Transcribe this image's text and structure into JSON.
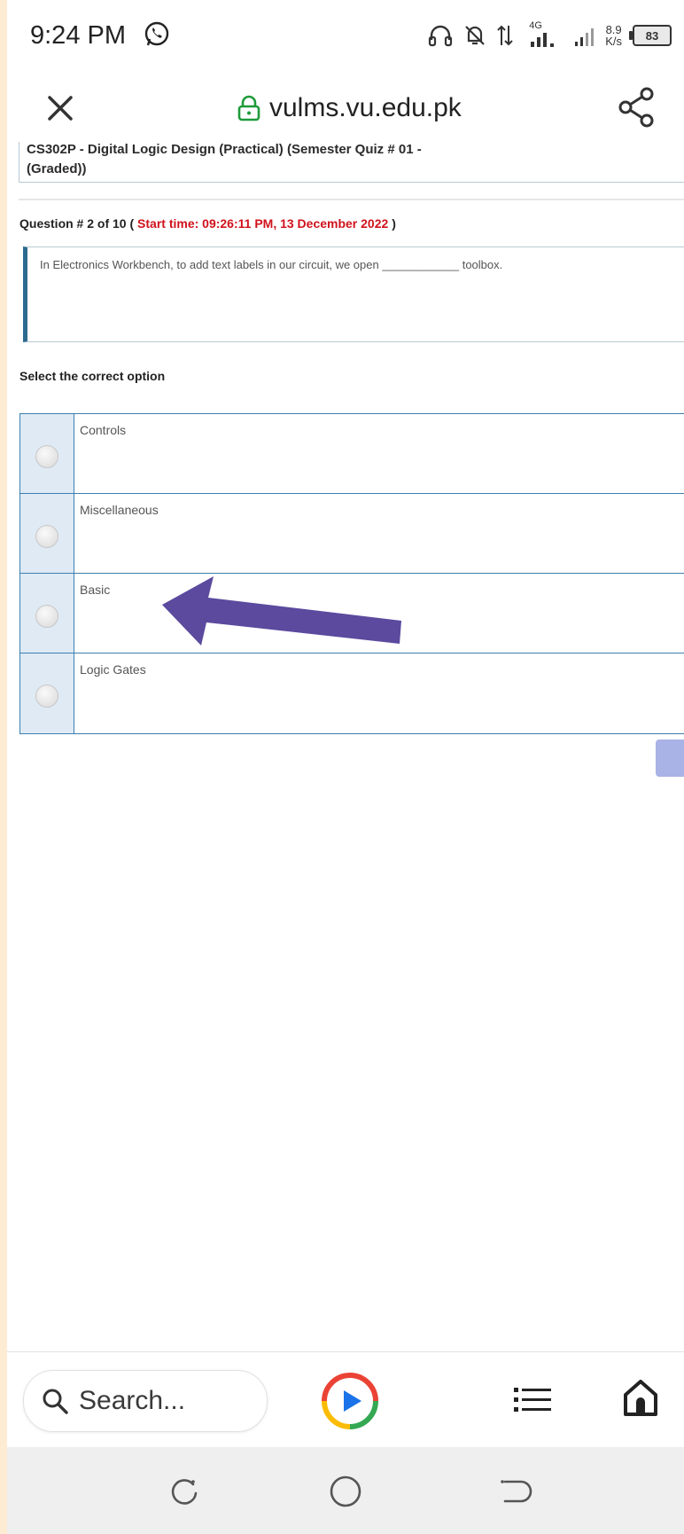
{
  "status_bar": {
    "time": "9:24 PM",
    "network_type": "4G",
    "net_speed_value": "8.9",
    "net_speed_unit": "K/s",
    "battery": "83"
  },
  "browser": {
    "url": "vulms.vu.edu.pk"
  },
  "quiz": {
    "course_title_line1": "CS302P - Digital Logic Design (Practical) (Semester Quiz # 01 -",
    "course_title_line2": "(Graded))",
    "question_prefix": "Question # 2 of 10 (",
    "start_time": "Start time: 09:26:11 PM, 13 December 2022",
    "question_suffix": ")",
    "question_text": "In Electronics Workbench, to add text labels in our circuit, we open ____________ toolbox.",
    "select_label": "Select the correct option",
    "options": [
      {
        "label": "Controls"
      },
      {
        "label": "Miscellaneous"
      },
      {
        "label": "Basic"
      },
      {
        "label": "Logic Gates"
      }
    ]
  },
  "bottom_bar": {
    "search_placeholder": "Search..."
  },
  "colors": {
    "accent_red": "#d0121b",
    "option_border": "#3d7fb0",
    "annotation_arrow": "#5b4a9e",
    "page_background": "#fdebd3"
  }
}
